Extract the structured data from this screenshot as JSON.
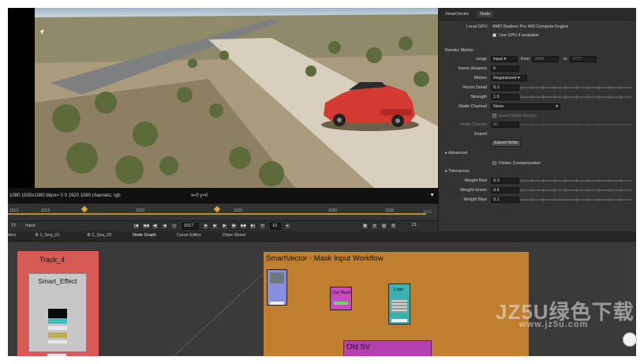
{
  "viewer": {
    "info_left": "1080 1920x1080  bbox= 0 0 1920 1080 channels: rgb",
    "info_coords": "x=0 y=0"
  },
  "timeline": {
    "ticks": [
      "1012",
      "1012",
      "1020",
      "1025",
      "1030",
      "1035"
    ],
    "end_label": "1033"
  },
  "transport": {
    "tf": "TF",
    "input": "Input",
    "frame": "1017",
    "step": "10",
    "fps": "21"
  },
  "tabs": [
    "ides",
    "1_Seq_01",
    "2_Seq_02",
    "Node Graph",
    "Curve Editor",
    "Dope Sheet"
  ],
  "props": {
    "tab1": "SmartVector",
    "tab2": "Node",
    "local_gpu_label": "Local GPU:",
    "local_gpu_value": "AMD Radeon Pro 460 Compute Engine",
    "use_gpu": "Use GPU if available",
    "render_motion": "Render Motion",
    "range_label": "range",
    "range_value": "input",
    "range_from_label": "from",
    "range_from": "2668",
    "range_to_label": "to",
    "range_to": "2777",
    "frame_distance_label": "frame distance",
    "frame_distance": "6",
    "motion_label": "Motion",
    "motion_value": "Regularized",
    "vector_detail_label": "Vector Detail",
    "vector_detail": "0.3",
    "strength_label": "Strength",
    "strength": "1.5",
    "matte_channel_label": "Matte Channel",
    "matte_channel": "None",
    "invert_matte": "Invert Matte Region",
    "matte_dilation_label": "Matte Dilation",
    "matte_dilation": "80",
    "export_label": "Export",
    "export_button": "Export Write",
    "advanced": "Advanced",
    "flicker": "Flicker Compensation",
    "tolerances": "Tolerances",
    "weight_red_label": "Weight Red",
    "weight_red": "0.3",
    "weight_green_label": "Weight Green",
    "weight_green": "0.6",
    "weight_blue_label": "Weight Blue",
    "weight_blue": "0.1"
  },
  "nodegraph": {
    "track4": "Track_4",
    "smart_effect": "Smart_Effect",
    "workflow": "SmartVector - Mask Input Workflow",
    "car_mask": "Car Mask",
    "logo": "Logo",
    "old_sv": "Old SV"
  },
  "watermark": {
    "title": "JZ5U绿色下载",
    "url": "www.jz5u.com"
  }
}
